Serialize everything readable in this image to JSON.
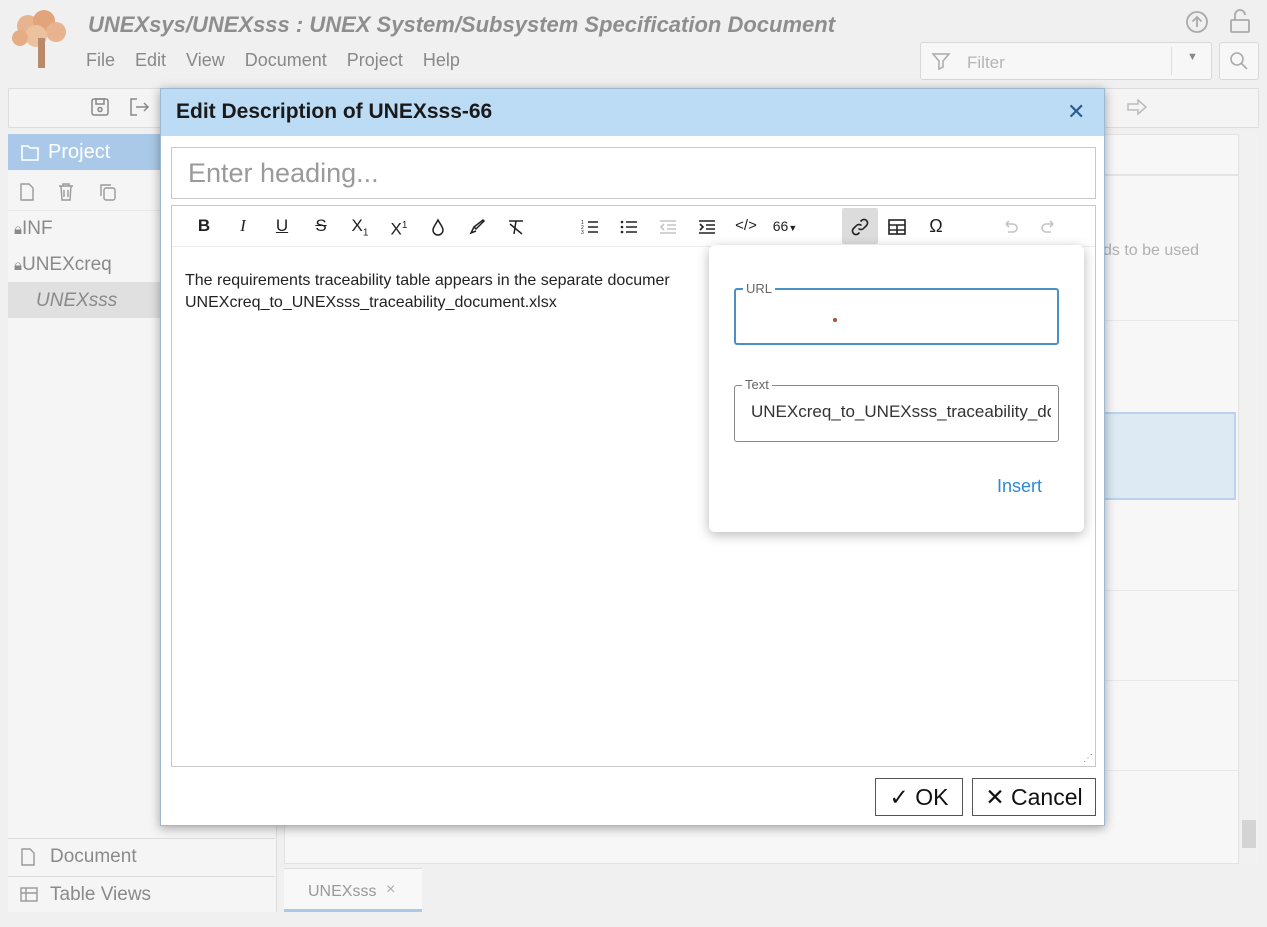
{
  "app": {
    "title": "UNEXsys/UNEXsss : UNEX System/Subsystem Specification Document",
    "menu": [
      "File",
      "Edit",
      "View",
      "Document",
      "Project",
      "Help"
    ],
    "filter_placeholder": "Filter"
  },
  "sidebar": {
    "header": "Project",
    "items": [
      {
        "label": "INF",
        "locked": true
      },
      {
        "label": "UNEXcreq",
        "locked": true
      },
      {
        "label": "UNEXsss",
        "selected": true
      }
    ],
    "bottom_tabs": [
      "Document",
      "Table Views"
    ]
  },
  "document_tab": {
    "label": "UNEXsss",
    "close": "×"
  },
  "background_text": "ds to be used",
  "dialog": {
    "title": "Edit Description of UNEXsss-66",
    "heading_placeholder": "Enter heading...",
    "body_line1": "The requirements traceability table appears in the separate documer",
    "body_line2": "UNEXcreq_to_UNEXsss_traceability_document.xlsx",
    "ok_label": "OK",
    "cancel_label": "Cancel",
    "quote_label": "66"
  },
  "link_popup": {
    "url_label": "URL",
    "url_value": "",
    "text_label": "Text",
    "text_value": "UNEXcreq_to_UNEXsss_traceability_document.xlsx",
    "insert_label": "Insert"
  },
  "colors": {
    "accent": "#2d8ad3",
    "dialog_header": "#bcdcf5",
    "sidebar_header": "#aac9e8"
  }
}
